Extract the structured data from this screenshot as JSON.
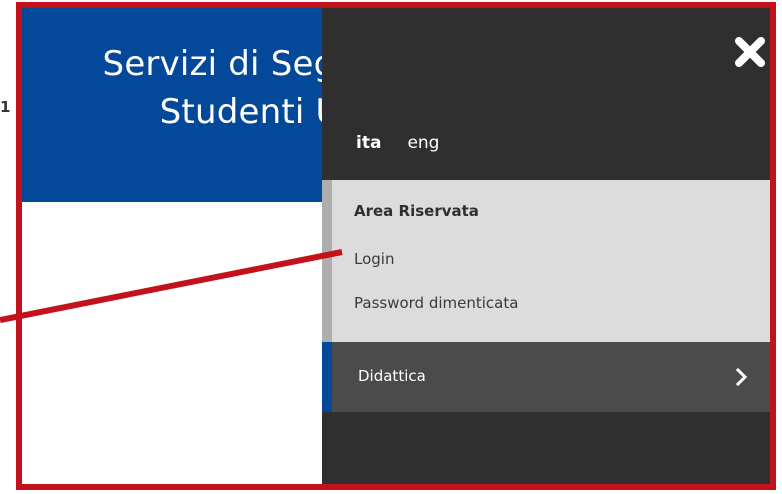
{
  "page": {
    "stray_char": "1"
  },
  "header": {
    "title_line1": "Servizi di Segreteria",
    "title_line2": "Studenti Univ"
  },
  "drawer": {
    "close_icon": "close-icon",
    "languages": [
      {
        "label": "ita",
        "active": true
      },
      {
        "label": "eng",
        "active": false
      }
    ],
    "reserved_area": {
      "title": "Area Riservata",
      "links": [
        "Login",
        "Password dimenticata"
      ]
    },
    "nav": {
      "label": "Didattica",
      "icon": "chevron-right-icon"
    }
  },
  "colors": {
    "highlight_frame": "#c3121b",
    "header_blue": "#04489a",
    "drawer_bg": "#2f2f2f",
    "reserved_bg": "#dcdcdc",
    "nav_bg": "#4b4b4b"
  }
}
